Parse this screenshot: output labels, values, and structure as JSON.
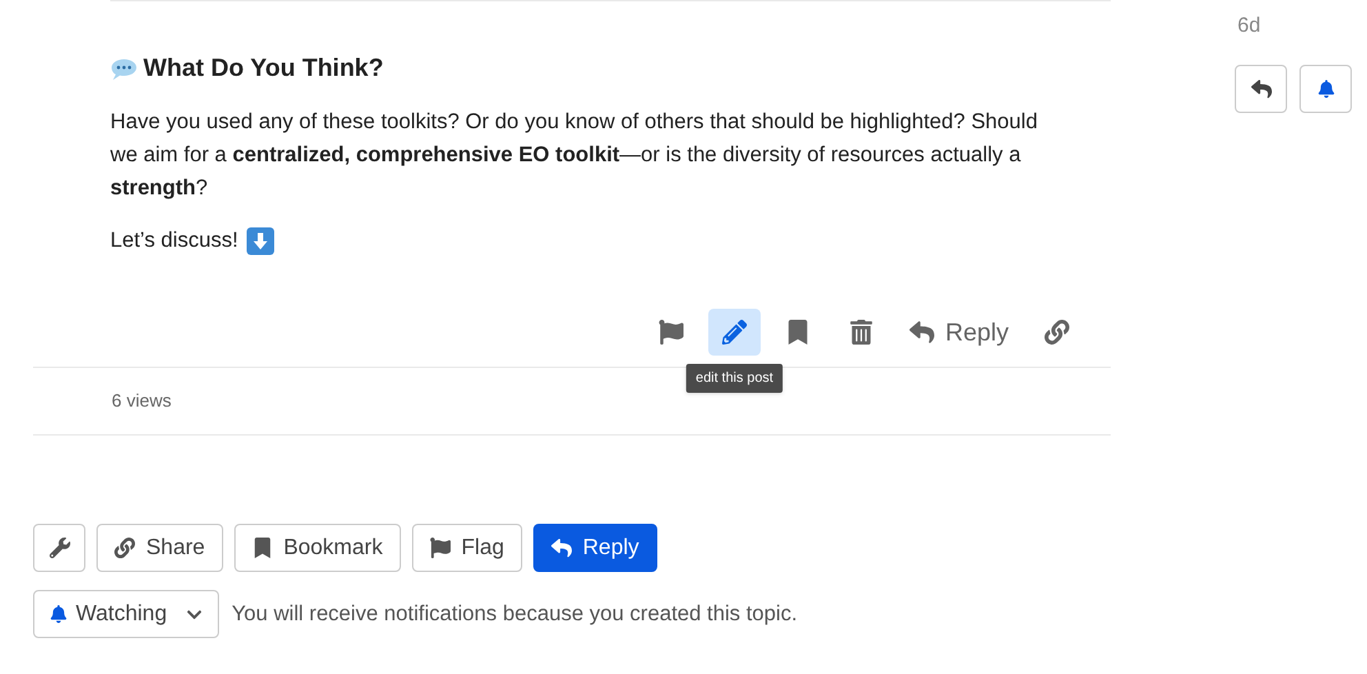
{
  "post": {
    "heading": "What Do You Think?",
    "paragraphs": [
      "Have you used any of these toolkits? Or do you know of others that should be highlighted? Should we aim for a **centralized, comprehensive EO toolkit**—or is the diversity of resources actually a **strength**?",
      "Let’s discuss!"
    ],
    "actions": [
      {
        "kind": "flag",
        "highlighted": false
      },
      {
        "kind": "edit",
        "highlighted": true,
        "tooltip": "edit this post"
      },
      {
        "kind": "bookmark",
        "highlighted": false
      },
      {
        "kind": "delete",
        "highlighted": false
      },
      {
        "kind": "reply",
        "highlighted": false,
        "label": "Reply"
      },
      {
        "kind": "link",
        "highlighted": false
      }
    ],
    "views": "6 views"
  },
  "timeline": {
    "age": "6d",
    "buttons": [
      {
        "kind": "reply"
      },
      {
        "kind": "bell"
      }
    ]
  },
  "footer_buttons": [
    {
      "kind": "wrench",
      "primary": false
    },
    {
      "kind": "share",
      "label": "Share",
      "primary": false
    },
    {
      "kind": "bookmark",
      "label": "Bookmark",
      "primary": false
    },
    {
      "kind": "flag",
      "label": "Flag",
      "primary": false
    },
    {
      "kind": "reply",
      "label": "Reply",
      "primary": true
    }
  ],
  "notifications": {
    "level": "Watching",
    "message": "You will receive notifications because you created this topic."
  }
}
